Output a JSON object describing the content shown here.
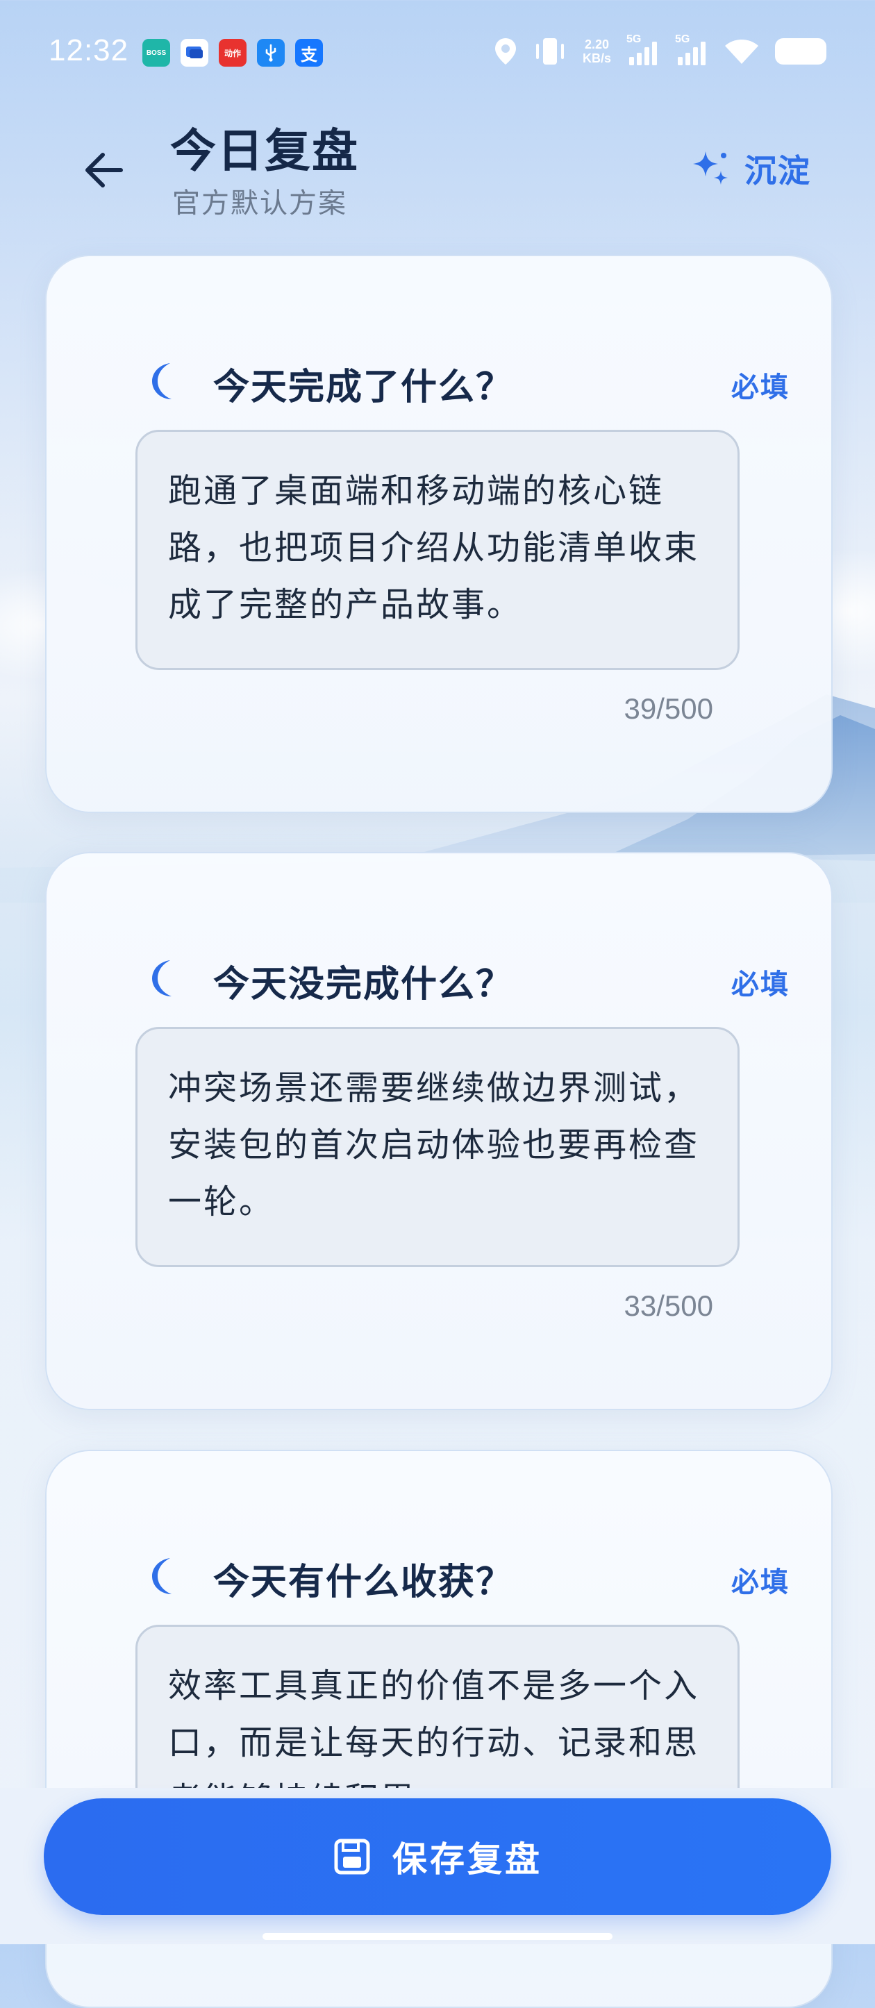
{
  "status_bar": {
    "time": "12:32",
    "app_icons": [
      {
        "name": "boss-zhipin-icon",
        "text": "BOSS",
        "color": "#1fb6a8"
      },
      {
        "name": "message-app-icon",
        "text": "",
        "color": "#ffffff"
      },
      {
        "name": "dongche-app-icon",
        "text": "动作",
        "color": "#e8322f"
      },
      {
        "name": "usb-icon",
        "text": "",
        "color": "#1e88f5"
      },
      {
        "name": "alipay-icon",
        "text": "支",
        "color": "#1677ff"
      }
    ],
    "net_speed_value": "2.20",
    "net_speed_unit": "KB/s",
    "signal_label_1": "5G",
    "signal_label_2": "5G"
  },
  "header": {
    "title": "今日复盘",
    "subtitle": "官方默认方案",
    "distill_label": "沉淀"
  },
  "cards": [
    {
      "title": "今天完成了什么？",
      "required": "必填",
      "answer": "跑通了桌面端和移动端的核心链路，也把项目介绍从功能清单收束成了完整的产品故事。",
      "count": "39/500"
    },
    {
      "title": "今天没完成什么？",
      "required": "必填",
      "answer": "冲突场景还需要继续做边界测试，安装包的首次启动体验也要再检查一轮。",
      "count": "33/500"
    },
    {
      "title": "今天有什么收获？",
      "required": "必填",
      "answer": "效率工具真正的价值不是多一个入口，而是让每天的行动、记录和思考能够持续积累。",
      "count": ""
    }
  ],
  "footer": {
    "save_label": "保存复盘"
  },
  "colors": {
    "accent": "#2f6fe8",
    "title": "#16294a",
    "button": "#2b6cf0"
  }
}
